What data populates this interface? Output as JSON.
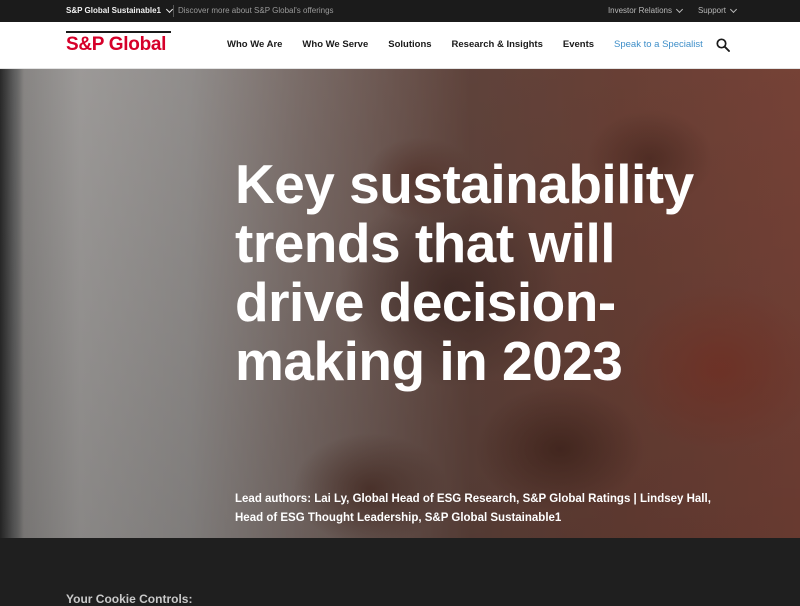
{
  "topbar": {
    "brand_select": "S&P Global Sustainable1",
    "discover": "Discover more about S&P Global's offerings",
    "investor_relations": "Investor Relations",
    "support": "Support"
  },
  "nav": {
    "logo": "S&P Global",
    "items": [
      {
        "label": "Who We Are"
      },
      {
        "label": "Who We Serve"
      },
      {
        "label": "Solutions"
      },
      {
        "label": "Research & Insights"
      },
      {
        "label": "Events"
      }
    ],
    "cta": "Speak to a Specialist",
    "search_icon": "search-icon"
  },
  "hero": {
    "title": "Key sustainability trends that will drive decision-making in 2023",
    "authors": "Lead authors: Lai Ly, Global Head of ESG Research, S&P Global Ratings | Lindsey Hall, Head of ESG Thought Leadership, S&P Global Sustainable1"
  },
  "cookie": {
    "title": "Your Cookie Controls:"
  },
  "colors": {
    "brand_red": "#d6002a",
    "cta_blue": "#3f8fc9",
    "topbar_bg": "#1b1b1b"
  }
}
